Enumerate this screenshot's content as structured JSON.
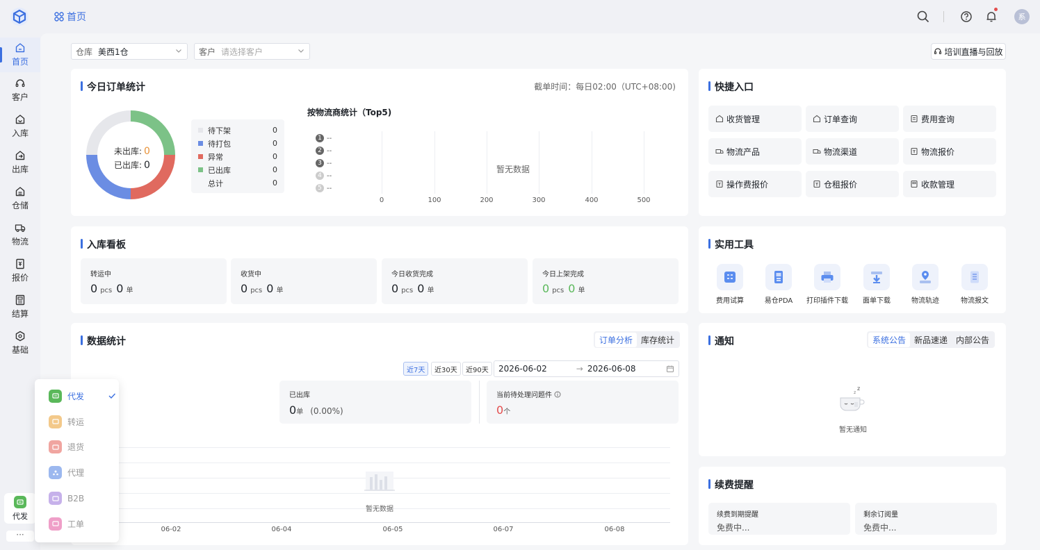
{
  "header": {
    "page_tab": "首页",
    "avatar_initial": "系"
  },
  "sidebar": {
    "items": [
      {
        "label": "首页",
        "icon": "home-icon"
      },
      {
        "label": "客户",
        "icon": "headset-icon"
      },
      {
        "label": "入库",
        "icon": "inbound-icon"
      },
      {
        "label": "出库",
        "icon": "outbound-icon"
      },
      {
        "label": "仓储",
        "icon": "warehouse-icon"
      },
      {
        "label": "物流",
        "icon": "truck-icon"
      },
      {
        "label": "报价",
        "icon": "quote-icon"
      },
      {
        "label": "结算",
        "icon": "settlement-icon"
      },
      {
        "label": "基础",
        "icon": "settings-icon"
      }
    ],
    "business_current": "代发",
    "more": "···"
  },
  "filters": {
    "warehouse_label": "仓库",
    "warehouse_value": "美西1仓",
    "customer_label": "客户",
    "customer_placeholder": "请选择客户",
    "training": "培训直播与回放"
  },
  "today": {
    "title": "今日订单统计",
    "cutoff": "截单时间：每日02:00（UTC+08:00)",
    "unshipped_label": "未出库:",
    "unshipped_value": "0",
    "shipped_label": "已出库:",
    "shipped_value": "0",
    "legend": [
      {
        "label": "待下架",
        "value": "0",
        "color": "#e6e7eb"
      },
      {
        "label": "待打包",
        "value": "0",
        "color": "#6b8de3"
      },
      {
        "label": "异常",
        "value": "0",
        "color": "#e06a5f"
      },
      {
        "label": "已出库",
        "value": "0",
        "color": "#7cc287"
      },
      {
        "label": "总计",
        "value": "0",
        "color": ""
      }
    ],
    "donut_segments": [
      0.25,
      0.25,
      0.25,
      0.25
    ],
    "carrier_title": "按物流商统计（Top5)",
    "ranks": [
      {
        "n": "1",
        "label": "--"
      },
      {
        "n": "2",
        "label": "--"
      },
      {
        "n": "3",
        "label": "--"
      },
      {
        "n": "4",
        "label": "--"
      },
      {
        "n": "5",
        "label": "--"
      }
    ],
    "x_ticks": [
      "0",
      "100",
      "200",
      "300",
      "400",
      "500"
    ],
    "no_data": "暂无数据"
  },
  "quick": {
    "title": "快捷入口",
    "items": [
      "收货管理",
      "订单查询",
      "费用查询",
      "物流产品",
      "物流渠道",
      "物流报价",
      "操作费报价",
      "仓租报价",
      "收款管理"
    ]
  },
  "inbound": {
    "title": "入库看板",
    "stats": [
      {
        "label": "转运中",
        "pcs": "0",
        "unit_pcs": "pcs",
        "orders": "0",
        "unit_orders": "单"
      },
      {
        "label": "收货中",
        "pcs": "0",
        "unit_pcs": "pcs",
        "orders": "0",
        "unit_orders": "单"
      },
      {
        "label": "今日收货完成",
        "pcs": "0",
        "unit_pcs": "pcs",
        "orders": "0",
        "unit_orders": "单"
      },
      {
        "label": "今日上架完成",
        "pcs": "0",
        "unit_pcs": "pcs",
        "orders": "0",
        "unit_orders": "单"
      }
    ]
  },
  "tools": {
    "title": "实用工具",
    "items": [
      "费用试算",
      "易仓PDA",
      "打印插件下载",
      "面单下载",
      "物流轨迹",
      "物流报文"
    ]
  },
  "data_stats": {
    "title": "数据统计",
    "tabs": [
      "订单分析",
      "库存统计"
    ],
    "ranges": [
      "近7天",
      "近30天",
      "近90天"
    ],
    "date_start": "2026-06-02",
    "date_end": "2026-06-08",
    "shipped_label": "已出库",
    "shipped_value": "0",
    "shipped_unit": "单",
    "shipped_pct": "(0.00%)",
    "issues_label": "当前待处理问题件",
    "issues_value": "0",
    "issues_unit": "个",
    "x_ticks": [
      "06-02",
      "06-04",
      "06-05",
      "06-07",
      "06-08"
    ],
    "no_data": "暂无数据"
  },
  "notice": {
    "title": "通知",
    "tabs": [
      "系统公告",
      "新品速递",
      "内部公告"
    ],
    "empty": "暂无通知"
  },
  "renewal": {
    "title": "续费提醒",
    "items": [
      {
        "label": "续费到期提醒",
        "value": "免费中..."
      },
      {
        "label": "剩余订阅量",
        "value": "免费中..."
      }
    ]
  },
  "business_popup": {
    "items": [
      {
        "label": "代发",
        "color": "#5ab85a",
        "active": true
      },
      {
        "label": "转运",
        "color": "#f3c98a",
        "active": false
      },
      {
        "label": "退货",
        "color": "#f0a5a0",
        "active": false
      },
      {
        "label": "代理",
        "color": "#9cb8ef",
        "active": false
      },
      {
        "label": "B2B",
        "color": "#c6b1ea",
        "active": false
      },
      {
        "label": "工单",
        "color": "#ef9fc8",
        "active": false
      }
    ]
  },
  "colors": {
    "accent": "#3b6fe0",
    "orange": "#e8933a",
    "red": "#e34d4d",
    "green": "#5ab85a"
  }
}
